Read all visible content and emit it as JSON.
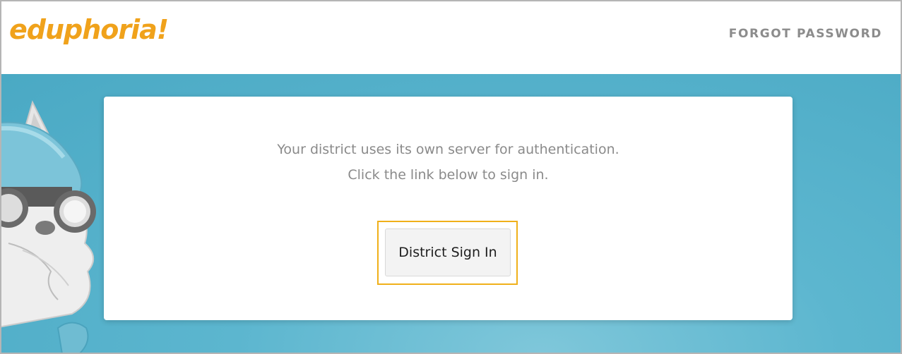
{
  "header": {
    "logo_text": "eduphoria!",
    "forgot_password_label": "FORGOT PASSWORD"
  },
  "card": {
    "message_line1": "Your district uses its own server for authentication.",
    "message_line2": "Click the link below to sign in.",
    "sign_in_button_label": "District Sign In"
  },
  "colors": {
    "brand": "#f0a21b",
    "hero_background": "#5cb6cf",
    "highlight_border": "#f0b01a"
  }
}
